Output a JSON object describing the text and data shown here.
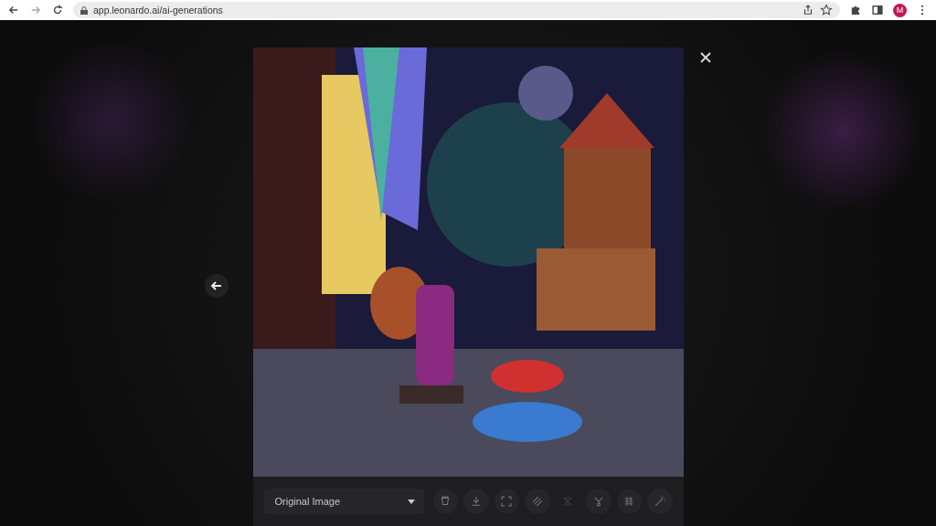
{
  "browser": {
    "url": "app.leonardo.ai/ai-generations",
    "profile_initial": "M"
  },
  "lightbox": {
    "toolbar": {
      "dropdown": "Original Image",
      "tools": [
        {
          "kind": "delete",
          "disabled": false
        },
        {
          "kind": "download",
          "disabled": false
        },
        {
          "kind": "expand",
          "disabled": false
        },
        {
          "kind": "stripes",
          "disabled": false
        },
        {
          "kind": "remove-bg",
          "disabled": true
        },
        {
          "kind": "variations",
          "disabled": false
        },
        {
          "kind": "grid",
          "disabled": false
        },
        {
          "kind": "wand",
          "disabled": false
        }
      ]
    }
  }
}
